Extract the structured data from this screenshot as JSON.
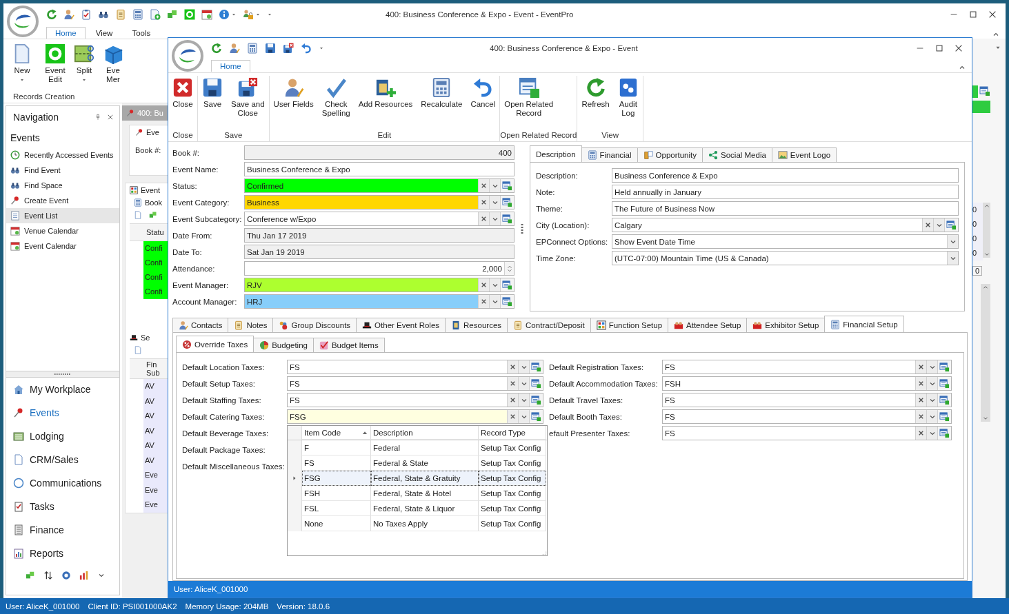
{
  "main_window": {
    "title": "400: Business Conference & Expo - Event - EventPro"
  },
  "main_ribbon": {
    "tabs": [
      {
        "label": "Home",
        "selected": true
      },
      {
        "label": "View",
        "selected": false
      },
      {
        "label": "Tools",
        "selected": false
      }
    ],
    "buttons": [
      {
        "label": "New",
        "kind": "new",
        "dropdown": true
      },
      {
        "label": "Event\nEdit",
        "kind": "gear",
        "dropdown": false
      },
      {
        "label": "Split",
        "kind": "split",
        "dropdown": true
      },
      {
        "label": "Eve\nMer",
        "kind": "cube",
        "dropdown": false
      }
    ],
    "group": "Records Creation"
  },
  "navigation": {
    "title": "Navigation",
    "section": "Events",
    "items": [
      {
        "label": "Recently Accessed Events",
        "selected": false
      },
      {
        "label": "Find Event",
        "selected": false
      },
      {
        "label": "Find Space",
        "selected": false
      },
      {
        "label": "Create Event",
        "selected": false
      },
      {
        "label": "Event List",
        "selected": true
      },
      {
        "label": "Venue Calendar",
        "selected": false
      },
      {
        "label": "Event Calendar",
        "selected": false
      }
    ],
    "modules": [
      {
        "label": "My Workplace",
        "selected": false
      },
      {
        "label": "Events",
        "selected": true
      },
      {
        "label": "Lodging",
        "selected": false
      },
      {
        "label": "CRM/Sales",
        "selected": false
      },
      {
        "label": "Communications",
        "selected": false
      },
      {
        "label": "Tasks",
        "selected": false
      },
      {
        "label": "Finance",
        "selected": false
      },
      {
        "label": "Reports",
        "selected": false
      }
    ]
  },
  "background_event": {
    "tab": "400: Bu",
    "group": "Eve",
    "book_label": "Book #:",
    "tabs": [
      "Event",
      "Book"
    ],
    "status_header": "Statu",
    "status_cells": [
      "Confi",
      "Confi",
      "Confi",
      "Confi"
    ],
    "section": "Se",
    "grid_header": "Fin\nSub",
    "grid_rows": [
      "AV",
      "AV",
      "AV",
      "AV",
      "AV",
      "AV",
      "Eve",
      "Eve",
      "Eve"
    ]
  },
  "background_right": {
    "cells": [
      "0",
      "0",
      "0",
      "0"
    ],
    "total": "0"
  },
  "dialog": {
    "title": "400: Business Conference & Expo - Event",
    "tabs": [
      {
        "label": "Home",
        "selected": true
      }
    ],
    "ribbon": [
      {
        "label": "Close",
        "buttons": [
          {
            "label": "Close",
            "kind": "close"
          }
        ]
      },
      {
        "label": "Save",
        "buttons": [
          {
            "label": "Save",
            "kind": "save"
          },
          {
            "label": "Save and\nClose",
            "kind": "save_close"
          }
        ]
      },
      {
        "label": "Edit",
        "buttons": [
          {
            "label": "User Fields",
            "kind": "user"
          },
          {
            "label": "Check\nSpelling",
            "kind": "spell"
          },
          {
            "label": "Add Resources",
            "kind": "resources"
          },
          {
            "label": "Recalculate",
            "kind": "calc"
          },
          {
            "label": "Cancel",
            "kind": "undo"
          }
        ]
      },
      {
        "label": "Open Related Record",
        "buttons": [
          {
            "label": "Open Related\nRecord",
            "kind": "related"
          }
        ]
      },
      {
        "label": "View",
        "buttons": [
          {
            "label": "Refresh",
            "kind": "refresh"
          },
          {
            "label": "Audit\nLog",
            "kind": "audit"
          }
        ]
      }
    ],
    "fields": [
      {
        "label": "Book #:",
        "value": "400",
        "kind": "number"
      },
      {
        "label": "Event Name:",
        "value": "Business Conference & Expo",
        "kind": "text"
      },
      {
        "label": "Status:",
        "value": "Confirmed",
        "kind": "lookup",
        "color": "#00ff00"
      },
      {
        "label": "Event Category:",
        "value": "Business",
        "kind": "lookup",
        "color": "#ffd700"
      },
      {
        "label": "Event Subcategory:",
        "value": "Conference w/Expo",
        "kind": "lookup"
      },
      {
        "label": "Date From:",
        "value": "Thu Jan 17 2019",
        "kind": "date"
      },
      {
        "label": "Date To:",
        "value": "Sat Jan 19 2019",
        "kind": "date"
      },
      {
        "label": "Attendance:",
        "value": "2,000",
        "kind": "spin"
      },
      {
        "label": "Event Manager:",
        "value": "RJV",
        "kind": "lookup",
        "color": "#adff2f"
      },
      {
        "label": "Account Manager:",
        "value": "HRJ",
        "kind": "lookup",
        "color": "#87cefa"
      }
    ],
    "detail_tabs": [
      {
        "label": "Description",
        "selected": true
      },
      {
        "label": "Financial",
        "selected": false
      },
      {
        "label": "Opportunity",
        "selected": false
      },
      {
        "label": "Social Media",
        "selected": false
      },
      {
        "label": "Event Logo",
        "selected": false
      }
    ],
    "detail_fields": [
      {
        "label": "Description:",
        "value": "Business Conference & Expo",
        "kind": "text"
      },
      {
        "label": "Note:",
        "value": "Held annually in January",
        "kind": "text"
      },
      {
        "label": "Theme:",
        "value": "The Future of Business Now",
        "kind": "text"
      },
      {
        "label": "City (Location):",
        "value": "Calgary",
        "kind": "lookup"
      },
      {
        "label": "EPConnect Options:",
        "value": "Show Event Date Time",
        "kind": "dropdown"
      },
      {
        "label": "Time Zone:",
        "value": "(UTC-07:00) Mountain Time (US & Canada)",
        "kind": "dropdown"
      }
    ],
    "record_tabs": [
      {
        "label": "Contacts",
        "selected": false
      },
      {
        "label": "Notes",
        "selected": false
      },
      {
        "label": "Group Discounts",
        "selected": false
      },
      {
        "label": "Other Event Roles",
        "selected": false
      },
      {
        "label": "Resources",
        "selected": false
      },
      {
        "label": "Contract/Deposit",
        "selected": false
      },
      {
        "label": "Function Setup",
        "selected": false
      },
      {
        "label": "Attendee Setup",
        "selected": false
      },
      {
        "label": "Exhibitor Setup",
        "selected": false
      },
      {
        "label": "Financial Setup",
        "selected": true
      }
    ],
    "financial_tabs": [
      {
        "label": "Override Taxes",
        "selected": true
      },
      {
        "label": "Budgeting",
        "selected": false
      },
      {
        "label": "Budget Items",
        "selected": false
      }
    ],
    "taxes_left": [
      {
        "label": "Default Location Taxes:",
        "value": "FS",
        "focused": false
      },
      {
        "label": "Default Setup Taxes:",
        "value": "FS",
        "focused": false
      },
      {
        "label": "Default Staffing Taxes:",
        "value": "FS",
        "focused": false
      },
      {
        "label": "Default Catering Taxes:",
        "value": "FSG",
        "focused": true
      },
      {
        "label": "Default Beverage Taxes:"
      },
      {
        "label": "Default Package Taxes:"
      },
      {
        "label": "Default Miscellaneous Taxes:"
      }
    ],
    "taxes_right": [
      {
        "label": "Default Registration Taxes:",
        "value": "FS"
      },
      {
        "label": "Default Accommodation Taxes:",
        "value": "FSH"
      },
      {
        "label": "Default Travel Taxes:",
        "value": "FS"
      },
      {
        "label": "Default Booth Taxes:",
        "value": "FS"
      },
      {
        "label": "efault Presenter Taxes:",
        "value": "FS"
      }
    ],
    "lookup_popup": {
      "columns": [
        {
          "label": "Item Code",
          "sorted_ascending": true
        },
        {
          "label": "Description"
        },
        {
          "label": "Record Type"
        }
      ],
      "rows": [
        {
          "cells": [
            "F",
            "Federal",
            "Setup Tax Config"
          ],
          "selected": false
        },
        {
          "cells": [
            "FS",
            "Federal & State",
            "Setup Tax Config"
          ],
          "selected": false
        },
        {
          "cells": [
            "FSG",
            "Federal, State & Gratuity",
            "Setup Tax Config"
          ],
          "selected": true
        },
        {
          "cells": [
            "FSH",
            "Federal, State & Hotel",
            "Setup Tax Config"
          ],
          "selected": false
        },
        {
          "cells": [
            "FSL",
            "Federal, State & Liquor",
            "Setup Tax Config"
          ],
          "selected": false
        },
        {
          "cells": [
            "None",
            "No Taxes Apply",
            "Setup Tax Config"
          ],
          "selected": false
        }
      ]
    },
    "status": "User: AliceK_001000"
  },
  "status_bar": {
    "items": [
      "User: AliceK_001000",
      "Client ID: PSI001000AK2",
      "Memory Usage: 204MB",
      "Version: 18.0.6"
    ]
  }
}
